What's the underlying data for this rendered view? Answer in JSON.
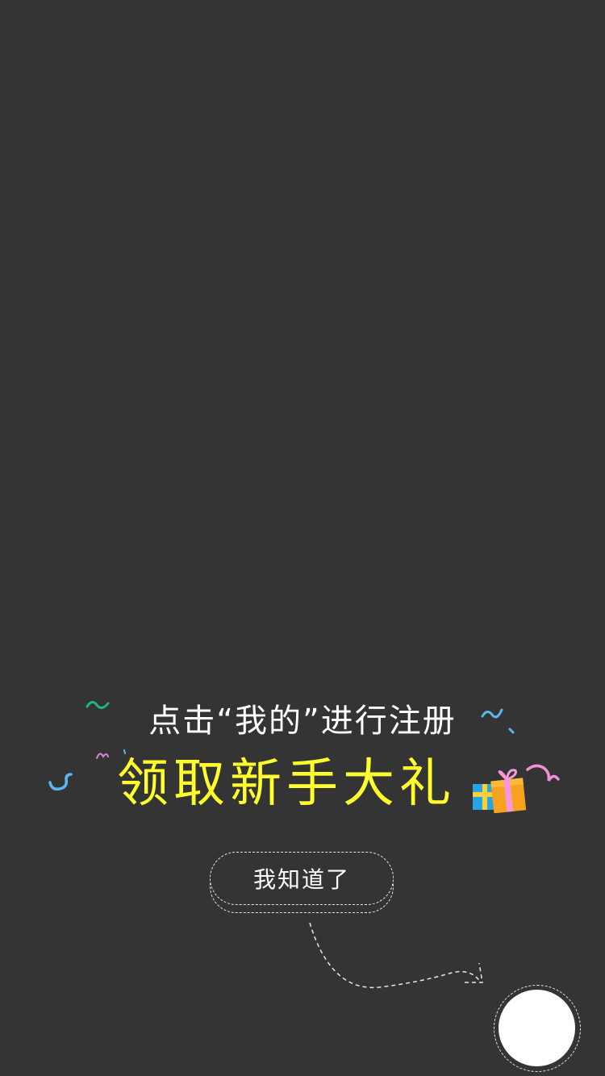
{
  "guide": {
    "line1": "点击“我的”进行注册",
    "line2": "领取新手大礼",
    "button_label": "我知道了",
    "gift_icon": "gift-box-icon",
    "colors": {
      "background": "#343434",
      "headline": "#ffff2e",
      "text": "#ffffff"
    }
  }
}
